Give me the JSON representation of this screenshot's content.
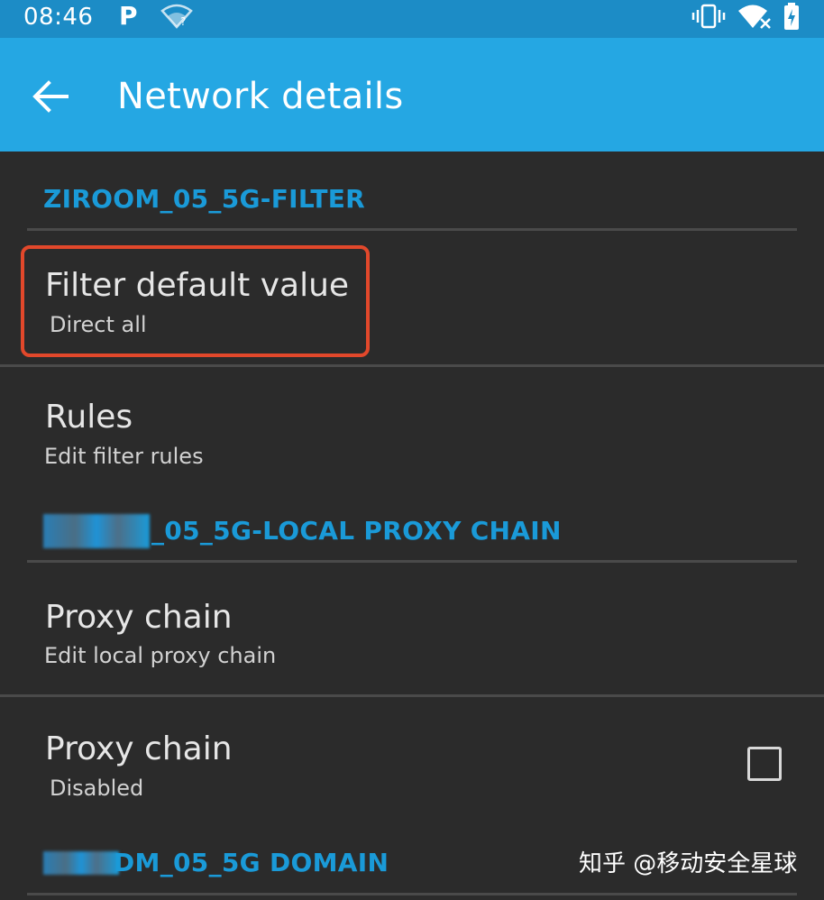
{
  "status_bar": {
    "time": "08:46",
    "notification_letter": "P",
    "icons": [
      "wifi-unknown-icon",
      "vibrate-icon",
      "wifi-no-internet-icon",
      "battery-charging-icon"
    ]
  },
  "app_bar": {
    "title": "Network details",
    "back_icon": "arrow-back-icon"
  },
  "sections": [
    {
      "header": "ZIROOM_05_5G-FILTER",
      "items": [
        {
          "title": "Filter default value",
          "summary": "Direct all",
          "highlighted": true
        },
        {
          "title": "Rules",
          "summary": "Edit filter rules"
        }
      ]
    },
    {
      "header": "_05_5G-LOCAL PROXY CHAIN",
      "header_prefix_obscured": true,
      "items": [
        {
          "title": "Proxy chain",
          "summary": "Edit local proxy chain"
        },
        {
          "title": "Proxy chain",
          "summary": "Disabled",
          "checkbox_checked": false
        }
      ]
    },
    {
      "header": "DM_05_5G DOMAIN",
      "header_prefix_obscured": true
    }
  ],
  "highlight_color": "#e2482b",
  "accent_color": "#1a9ad8",
  "watermark": "知乎 @移动安全星球"
}
